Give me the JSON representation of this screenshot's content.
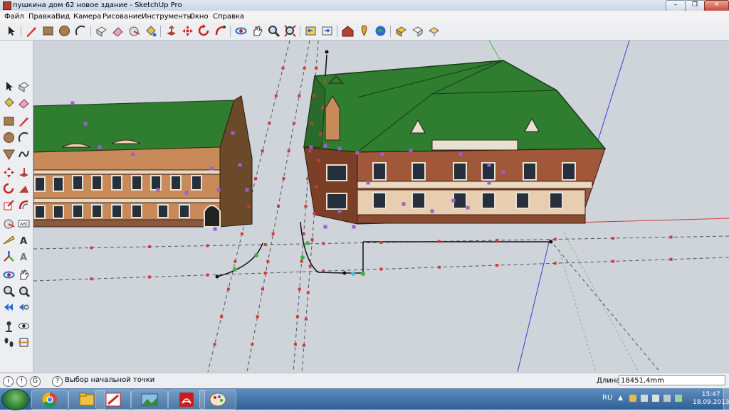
{
  "window": {
    "title": "пушкина дом 62 новое здание - SketchUp Pro",
    "minimize_label": "–",
    "maximize_label": "❐",
    "close_label": "✕"
  },
  "menu": {
    "items": [
      "Файл",
      "Правка",
      "Вид",
      "Камера",
      "Рисование",
      "Инструменты",
      "Окно",
      "Справка"
    ]
  },
  "toolbar": {
    "icons": [
      "select-icon",
      "pencil-icon",
      "rectangle-icon",
      "circle-icon",
      "arc-icon",
      "make-component-icon",
      "eraser-icon",
      "paint-bucket-icon",
      "push-pull-icon",
      "move-icon",
      "rotate-icon",
      "follow-me-icon",
      "orbit-icon",
      "pan-icon",
      "zoom-icon",
      "zoom-extents-icon",
      "previous-view-icon",
      "next-view-icon",
      "warehouse-icon",
      "add-location-icon",
      "google-earth-icon",
      "get-models-icon",
      "share-model-icon"
    ]
  },
  "status": {
    "help_icons": [
      "info-icon",
      "credit-icon",
      "user-icon"
    ],
    "prompt": "Выбор начальной точки",
    "distance_label": "Длина",
    "distance_value": "18451,4mm"
  },
  "taskbar": {
    "apps": [
      "chrome-icon",
      "explorer-icon",
      "sketchup-icon",
      "image-viewer-icon",
      "acrobat-icon",
      "paint-icon"
    ],
    "language": "RU",
    "time": "15:47",
    "date": "18.09.2013"
  },
  "colors": {
    "roof_green": "#2f7d2f",
    "brick": "#a0573a",
    "facade_tan": "#c98a5a",
    "viewport_bg": "#cfd4da",
    "inference_purple": "#9a5fd0",
    "guide_red": "#d23a3a"
  }
}
